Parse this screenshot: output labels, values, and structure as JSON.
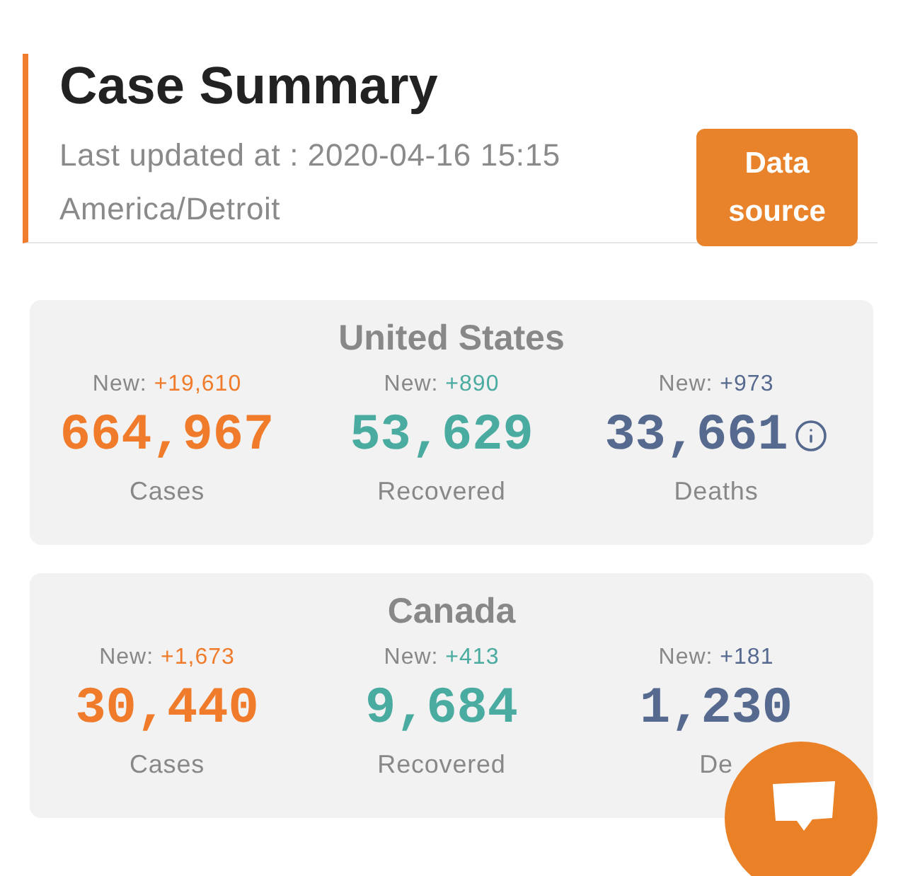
{
  "header": {
    "title": "Case Summary",
    "updated": "Last updated at : 2020-04-16 15:15 America/Detroit",
    "button": "Data source"
  },
  "regions": [
    {
      "name": "United States",
      "stats": [
        {
          "kind": "cases",
          "new_label": "New:",
          "new_value": "+19,610",
          "value": "664,967",
          "label": "Cases",
          "info": false
        },
        {
          "kind": "recovered",
          "new_label": "New:",
          "new_value": "+890",
          "value": "53,629",
          "label": "Recovered",
          "info": false
        },
        {
          "kind": "deaths",
          "new_label": "New:",
          "new_value": "+973",
          "value": "33,661",
          "label": "Deaths",
          "info": true
        }
      ]
    },
    {
      "name": "Canada",
      "stats": [
        {
          "kind": "cases",
          "new_label": "New:",
          "new_value": "+1,673",
          "value": "30,440",
          "label": "Cases",
          "info": false
        },
        {
          "kind": "recovered",
          "new_label": "New:",
          "new_value": "+413",
          "value": "9,684",
          "label": "Recovered",
          "info": false
        },
        {
          "kind": "deaths",
          "new_label": "New:",
          "new_value": "+181",
          "value": "1,230",
          "label": "De",
          "info": false
        }
      ]
    }
  ]
}
